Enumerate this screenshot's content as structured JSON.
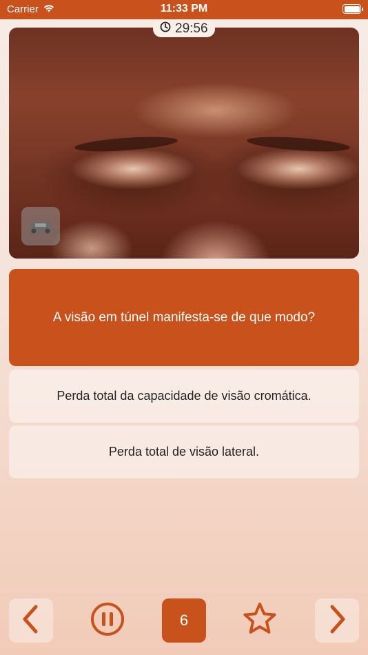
{
  "status_bar": {
    "carrier": "Carrier",
    "time": "11:33 PM"
  },
  "timer": {
    "value": "29:56",
    "icon": "clock-icon"
  },
  "image": {
    "overlay_icon": "car-icon"
  },
  "question": {
    "text": "A visão em túnel manifesta-se de que modo?"
  },
  "answers": [
    {
      "text": "Perda total da capacidade de visão cromática."
    },
    {
      "text": "Perda total de visão lateral."
    }
  ],
  "toolbar": {
    "prev_icon": "chevron-left-icon",
    "pause_icon": "pause-icon",
    "page_number": "6",
    "star_icon": "star-icon",
    "next_icon": "chevron-right-icon"
  },
  "colors": {
    "accent": "#c8511c",
    "background_top": "#f7ece7",
    "background_bottom": "#f2cbb8"
  }
}
